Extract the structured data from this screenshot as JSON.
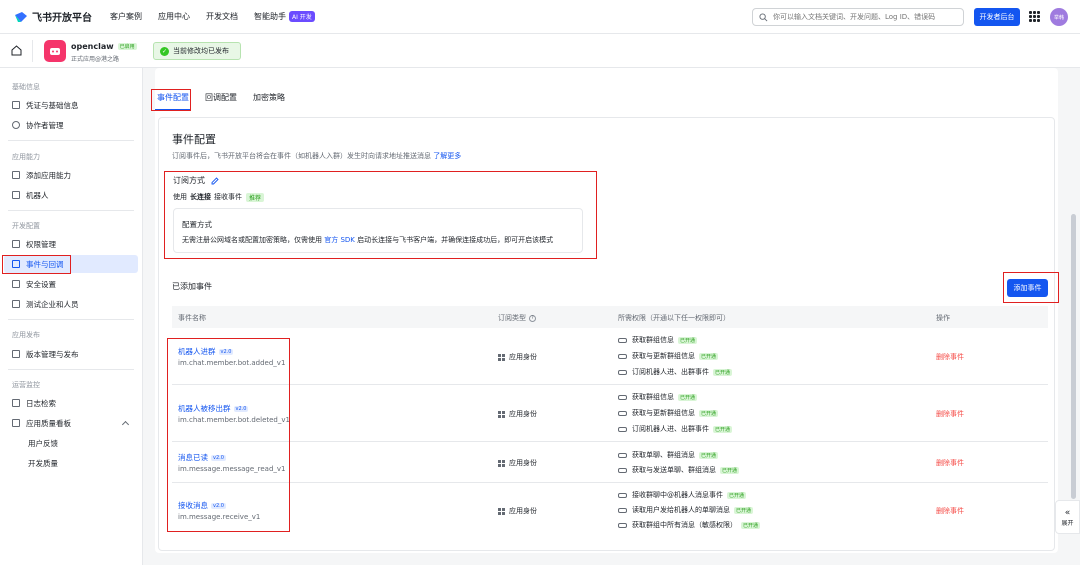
{
  "topbar": {
    "logo_text": "飞书开放平台",
    "nav": [
      "客户案例",
      "应用中心",
      "开发文档",
      "智能助手"
    ],
    "ai_badge": "AI 开发",
    "search_placeholder": "你可以输入文档关键词、开发问题、Log ID、错误码",
    "dev_button": "开发者后台",
    "avatar_text": "举韩"
  },
  "appbar": {
    "app_name": "openclaw",
    "enabled_tag": "已启用",
    "app_sub": "正式应用@港之路",
    "toast": "当前修改均已发布"
  },
  "sidebar": {
    "groups": [
      "基础信息",
      "应用能力",
      "开发配置",
      "应用发布",
      "运营监控"
    ],
    "items": [
      "凭证与基础信息",
      "协作者管理",
      "添加应用能力",
      "机器人",
      "权限管理",
      "事件与回调",
      "安全设置",
      "测试企业和人员",
      "版本管理与发布",
      "日志检索",
      "应用质量看板",
      "用户反馈",
      "开发质量"
    ]
  },
  "tabs": [
    "事件配置",
    "回调配置",
    "加密策略"
  ],
  "event_config": {
    "title": "事件配置",
    "desc": "订阅事件后，飞书开放平台将会在事件（如机器人入群）发生时向请求地址推送消息",
    "learn_more": "了解更多",
    "sub_title": "订阅方式",
    "use_prefix": "使用",
    "use_bold": "长连接",
    "use_suffix": "接收事件",
    "rec_tag": "推荐",
    "cfg_title": "配置方式",
    "cfg_text_1": "无需注册公网域名或配置加密策略，仅需使用",
    "cfg_link": "官方 SDK",
    "cfg_text_2": "启动长连接与飞书客户端，并确保连接成功后，即可开启该模式"
  },
  "added": {
    "title": "已添加事件",
    "add_button": "添加事件",
    "headers": [
      "事件名称",
      "订阅类型",
      "所需权限（开通以下任一权限即可）",
      "操作"
    ],
    "rows": [
      {
        "name": "机器人进群",
        "ver": "v2.0",
        "key": "im.chat.member.bot.added_v1",
        "type": "应用身份",
        "perms": [
          "获取群组信息",
          "获取与更新群组信息",
          "订阅机器人进、出群事件"
        ],
        "action": "删除事件"
      },
      {
        "name": "机器人被移出群",
        "ver": "v2.0",
        "key": "im.chat.member.bot.deleted_v1",
        "type": "应用身份",
        "perms": [
          "获取群组信息",
          "获取与更新群组信息",
          "订阅机器人进、出群事件"
        ],
        "action": "删除事件"
      },
      {
        "name": "消息已读",
        "ver": "v2.0",
        "key": "im.message.message_read_v1",
        "type": "应用身份",
        "perms": [
          "获取单聊、群组消息",
          "获取与发送单聊、群组消息"
        ],
        "action": "删除事件"
      },
      {
        "name": "接收消息",
        "ver": "v2.0",
        "key": "im.message.receive_v1",
        "type": "应用身份",
        "perms": [
          "接收群聊中@机器人消息事件",
          "读取用户发给机器人的单聊消息",
          "获取群组中所有消息（敏感权限）"
        ],
        "action": "删除事件"
      }
    ],
    "opened_tag": "已开通"
  },
  "expand_label": "展开"
}
